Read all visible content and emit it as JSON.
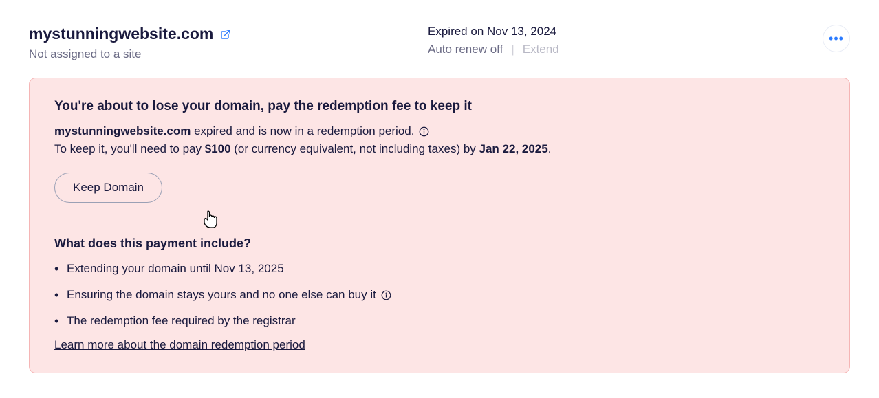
{
  "header": {
    "domain": "mystunningwebsite.com",
    "assignment": "Not assigned to a site",
    "expired": "Expired on Nov 13, 2024",
    "autorenew": "Auto renew off",
    "extend": "Extend"
  },
  "alert": {
    "title": "You're about to lose your domain, pay the redemption fee to keep it",
    "line1_domain": "mystunningwebsite.com",
    "line1_rest": " expired and is now in a redemption period. ",
    "line2_a": "To keep it, you'll need to pay ",
    "line2_amount": "$100",
    "line2_b": " (or currency equivalent, not including taxes) by ",
    "line2_date": "Jan 22, 2025",
    "line2_c": ".",
    "keep_button": "Keep Domain",
    "includes_title": "What does this payment include?",
    "includes": [
      "Extending your domain until Nov 13, 2025",
      "Ensuring the domain stays yours and no one else can buy it ",
      "The redemption fee required by the registrar"
    ],
    "learn_more": "Learn more about the domain redemption period"
  }
}
